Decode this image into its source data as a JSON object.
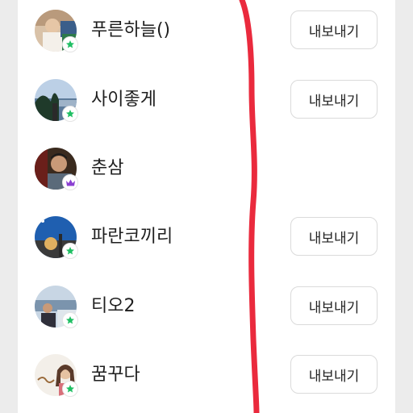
{
  "members": [
    {
      "name": "푸른하늘()",
      "badge": "star-badge",
      "action": "내보내기",
      "avatar": "photo-avatar-1"
    },
    {
      "name": "사이좋게",
      "badge": "star-badge",
      "action": "내보내기",
      "avatar": "photo-avatar-2"
    },
    {
      "name": "춘삼",
      "badge": "crown-badge",
      "action": "",
      "avatar": "photo-avatar-3"
    },
    {
      "name": "파란코끼리",
      "badge": "star-badge",
      "action": "내보내기",
      "avatar": "photo-avatar-4"
    },
    {
      "name": "티오2",
      "badge": "star-badge",
      "action": "내보내기",
      "avatar": "photo-avatar-5"
    },
    {
      "name": "꿈꾸다",
      "badge": "star-badge",
      "action": "내보내기",
      "avatar": "photo-avatar-6"
    }
  ],
  "colors": {
    "star_badge": "#1fbf63",
    "crown_badge": "#8a3fd1",
    "annotation_stroke": "#e8182c"
  }
}
